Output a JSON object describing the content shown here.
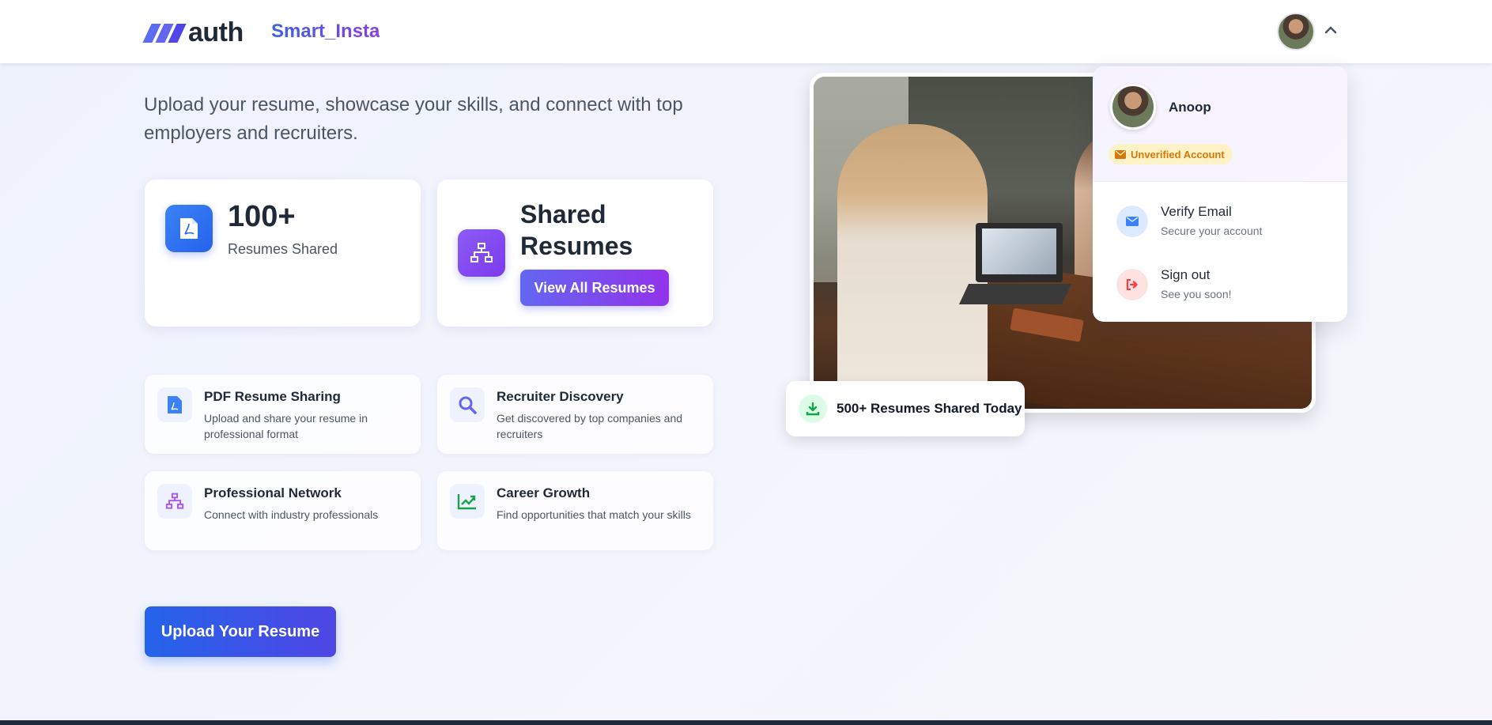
{
  "header": {
    "logo_text": "auth",
    "brand": "Smart_Insta"
  },
  "hero": {
    "tagline": "Upload your resume, showcase your skills, and connect with top employers and recruiters."
  },
  "stats": [
    {
      "value": "100+",
      "label": "Resumes Shared",
      "icon": "pdf-icon"
    },
    {
      "title": "Shared Resumes",
      "button": "View All Resumes",
      "icon": "sitemap-icon"
    }
  ],
  "features": [
    {
      "title": "PDF Resume Sharing",
      "desc": "Upload and share your resume in professional format",
      "icon": "pdf-icon",
      "color": "#3b82f6"
    },
    {
      "title": "Recruiter Discovery",
      "desc": "Get discovered by top companies and recruiters",
      "icon": "search-icon",
      "color": "#6366f1"
    },
    {
      "title": "Professional Network",
      "desc": "Connect with industry professionals",
      "icon": "sitemap-icon",
      "color": "#a855f7"
    },
    {
      "title": "Career Growth",
      "desc": "Find opportunities that match your skills",
      "icon": "chart-line-icon",
      "color": "#16a34a"
    }
  ],
  "cta": {
    "upload_label": "Upload Your Resume"
  },
  "badge_today": {
    "text": "500+ Resumes Shared Today"
  },
  "dropdown": {
    "name": "Anoop",
    "account_status": "Unverified Account",
    "items": [
      {
        "title": "Verify Email",
        "subtitle": "Secure your account",
        "icon": "envelope-icon"
      },
      {
        "title": "Sign out",
        "subtitle": "See you soon!",
        "icon": "sign-out-icon"
      }
    ]
  },
  "colors": {
    "primary": "#2563eb",
    "accent": "#9333ea",
    "warning": "#d97706",
    "danger": "#ef4444",
    "success": "#16a34a"
  }
}
